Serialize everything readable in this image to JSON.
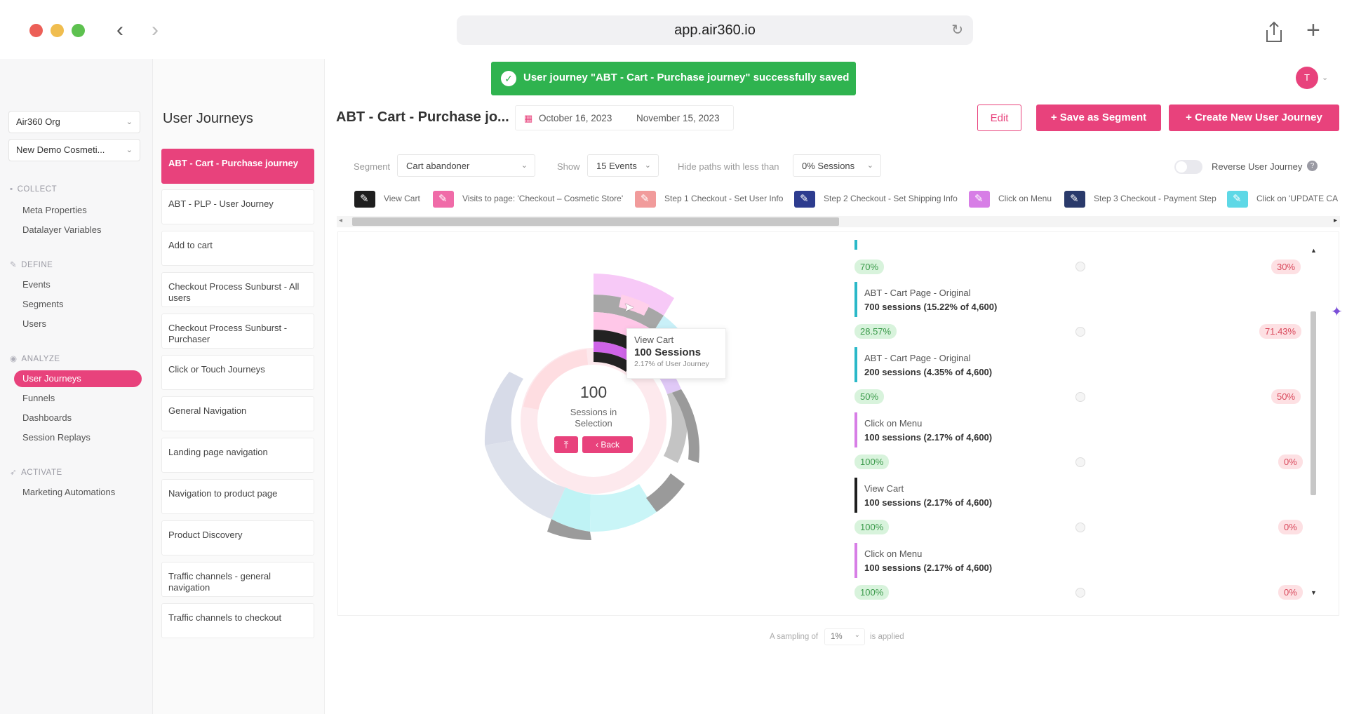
{
  "browser": {
    "url": "app.air360.io"
  },
  "toast": {
    "message": "User journey \"ABT - Cart - Purchase journey\" successfully saved"
  },
  "avatar": {
    "initial": "T"
  },
  "sidebar": {
    "org": "Air360 Org",
    "project": "New Demo Cosmeti...",
    "sections": [
      {
        "title": "COLLECT",
        "items": [
          "Meta Properties",
          "Datalayer Variables"
        ]
      },
      {
        "title": "DEFINE",
        "items": [
          "Events",
          "Segments",
          "Users"
        ]
      },
      {
        "title": "ANALYZE",
        "items": [
          "User Journeys",
          "Funnels",
          "Dashboards",
          "Session Replays"
        ]
      },
      {
        "title": "ACTIVATE",
        "items": [
          "Marketing Automations"
        ]
      }
    ]
  },
  "journeys": {
    "title": "User Journeys",
    "items": [
      "ABT - Cart - Purchase journey",
      "ABT - PLP - User Journey",
      "Add to cart",
      "Checkout Process Sunburst - All users",
      "Checkout Process Sunburst - Purchaser",
      "Click or Touch Journeys",
      "General Navigation",
      "Landing page navigation",
      "Navigation to product page",
      "Product Discovery",
      "Traffic channels - general navigation",
      "Traffic channels to checkout"
    ]
  },
  "header": {
    "title": "ABT - Cart - Purchase jo...",
    "date_from": "October 16, 2023",
    "date_to": "November 15, 2023",
    "edit": "Edit",
    "save_segment": "Save as Segment",
    "create_new": "Create New User Journey"
  },
  "filters": {
    "segment_label": "Segment",
    "segment_value": "Cart abandoner",
    "show_label": "Show",
    "show_value": "15 Events",
    "hide_label": "Hide paths with less than",
    "hide_value": "0% Sessions",
    "reverse_label": "Reverse User Journey"
  },
  "steps": [
    {
      "label": "View Cart",
      "color": "#1f1f1f"
    },
    {
      "label": "Visits to page: 'Checkout – Cosmetic Store'",
      "color": "#f06ba8"
    },
    {
      "label": "Step 1 Checkout - Set User Info",
      "color": "#f19b9b"
    },
    {
      "label": "Step 2 Checkout - Set Shipping Info",
      "color": "#2d3c8f"
    },
    {
      "label": "Click on Menu",
      "color": "#d77ee6"
    },
    {
      "label": "Step 3 Checkout - Payment Step",
      "color": "#2a3a6b"
    },
    {
      "label": "Click on 'UPDATE CA",
      "color": "#5ed8e6"
    }
  ],
  "sunburst": {
    "center_value": "100",
    "center_label_1": "Sessions in",
    "center_label_2": "Selection",
    "back": "Back",
    "tooltip": {
      "title": "View Cart",
      "sessions": "100 Sessions",
      "share": "2.17% of User Journey"
    }
  },
  "details": [
    {
      "left": "70%",
      "right": "30%"
    },
    {
      "title": "ABT - Cart Page - Original",
      "sessions": "700 sessions (15.22% of 4,600)",
      "color": "#2ab8c8",
      "left": "28.57%",
      "right": "71.43%"
    },
    {
      "title": "ABT - Cart Page - Original",
      "sessions": "200 sessions (4.35% of 4,600)",
      "color": "#2ab8c8",
      "left": "50%",
      "right": "50%"
    },
    {
      "title": "Click on Menu",
      "sessions": "100 sessions (2.17% of 4,600)",
      "color": "#d77ee6",
      "left": "100%",
      "right": "0%"
    },
    {
      "title": "View Cart",
      "sessions": "100 sessions (2.17% of 4,600)",
      "color": "#1f1f1f",
      "left": "100%",
      "right": "0%"
    },
    {
      "title": "Click on Menu",
      "sessions": "100 sessions (2.17% of 4,600)",
      "color": "#d77ee6",
      "left": "100%",
      "right": "0%"
    }
  ],
  "sampling": {
    "prefix": "A sampling of",
    "value": "1%",
    "suffix": "is applied"
  }
}
